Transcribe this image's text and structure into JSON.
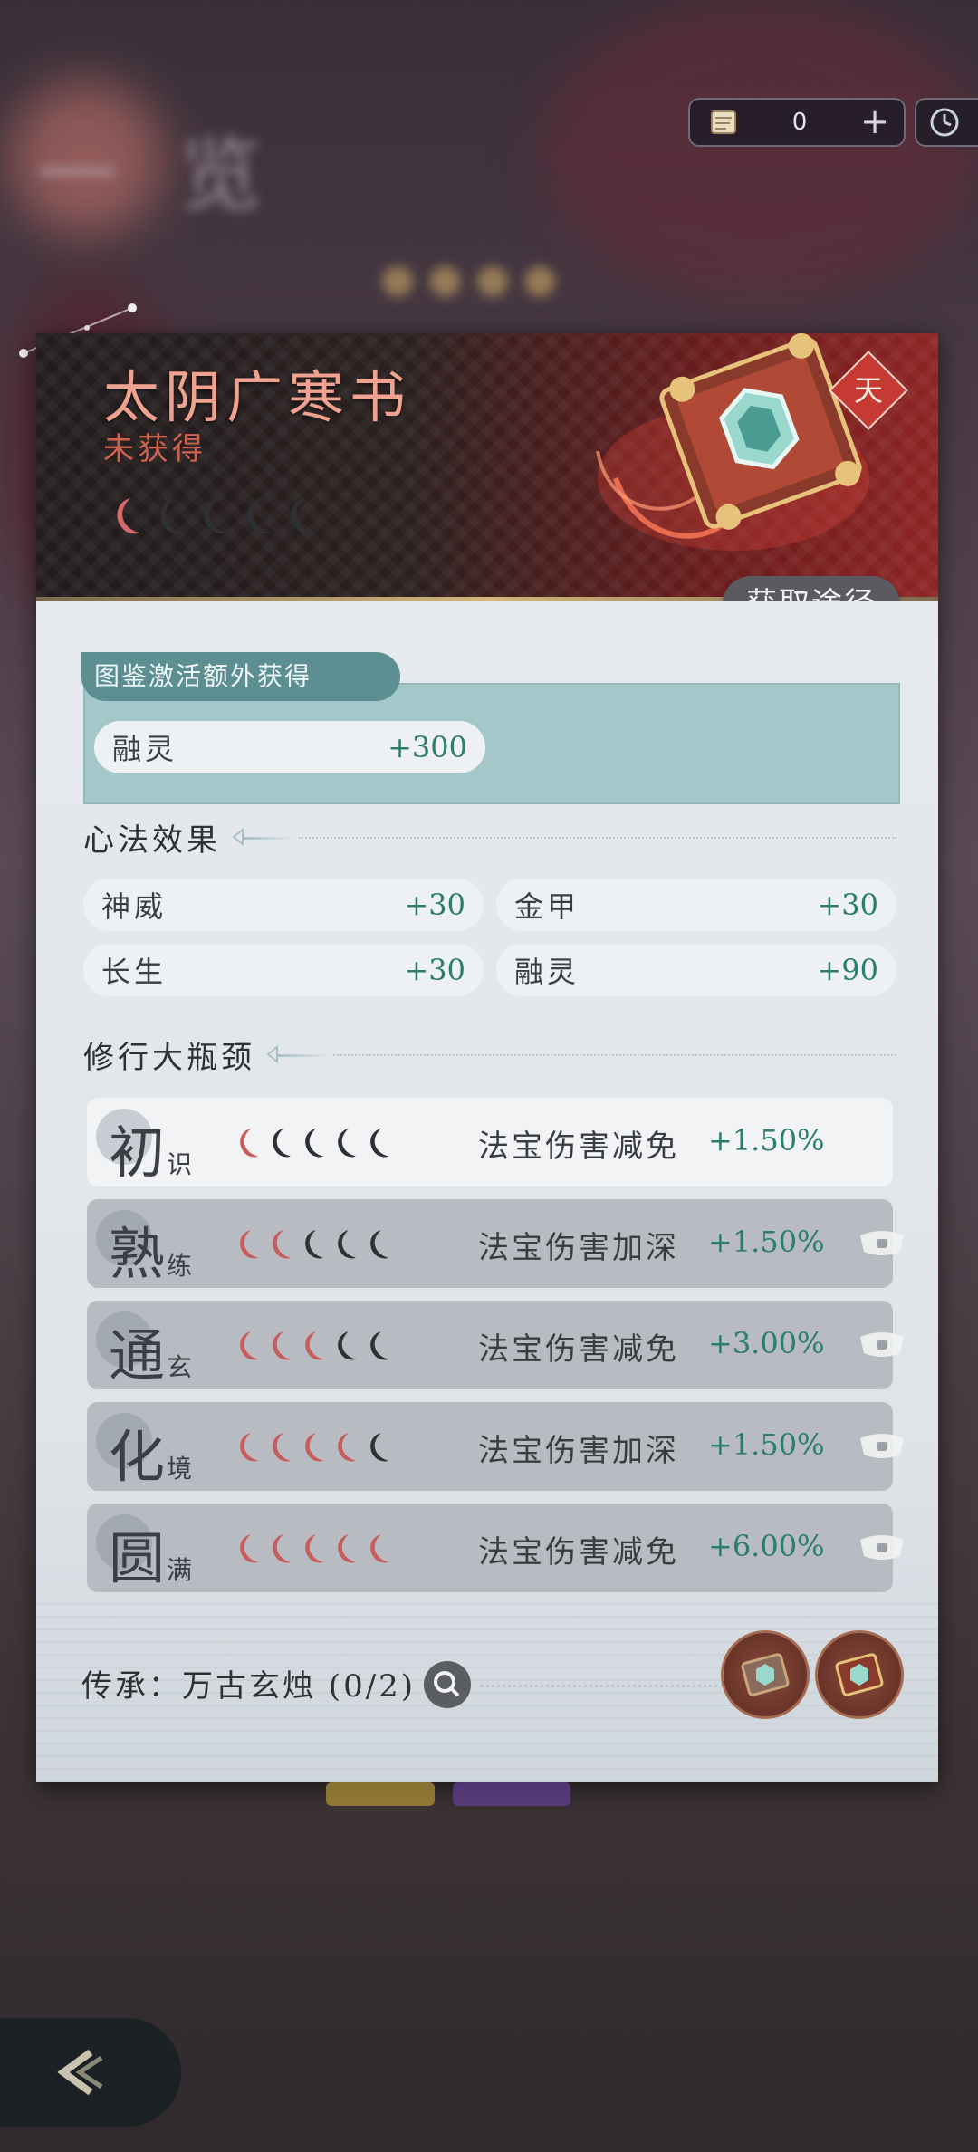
{
  "currency": {
    "count": "0",
    "plus": "+"
  },
  "item": {
    "name": "太阴广寒书",
    "status": "未获得",
    "grade_badge": "天",
    "stars_filled": 1,
    "stars_total": 5,
    "acquire_label": "获取途径"
  },
  "tujian": {
    "tab_label": "图鉴激活额外获得",
    "bonus": {
      "key": "融灵",
      "value": "+300"
    }
  },
  "xinfa": {
    "title": "心法效果",
    "stats": [
      {
        "key": "神威",
        "value": "+30"
      },
      {
        "key": "金甲",
        "value": "+30"
      },
      {
        "key": "长生",
        "value": "+30"
      },
      {
        "key": "融灵",
        "value": "+90"
      }
    ]
  },
  "bottleneck": {
    "title": "修行大瓶颈",
    "rows": [
      {
        "big": "初",
        "small": "识",
        "filled": 1,
        "effect": "法宝伤害减免",
        "value": "+1.50%",
        "locked": false
      },
      {
        "big": "熟",
        "small": "练",
        "filled": 2,
        "effect": "法宝伤害加深",
        "value": "+1.50%",
        "locked": true
      },
      {
        "big": "通",
        "small": "玄",
        "filled": 3,
        "effect": "法宝伤害减免",
        "value": "+3.00%",
        "locked": true
      },
      {
        "big": "化",
        "small": "境",
        "filled": 4,
        "effect": "法宝伤害加深",
        "value": "+1.50%",
        "locked": true
      },
      {
        "big": "圆",
        "small": "满",
        "filled": 5,
        "effect": "法宝伤害减免",
        "value": "+6.00%",
        "locked": true
      }
    ]
  },
  "inherit": {
    "label": "传承：万古玄烛 (0/2)"
  },
  "colors": {
    "accent_red": "#d0624e",
    "value_green": "#2c7d6e",
    "tujian_bg": "#a4c8c9"
  },
  "icons": [
    "scroll-icon",
    "plus-icon",
    "clock-icon",
    "moon-icon",
    "lock-icon",
    "search-icon",
    "back-icon"
  ]
}
